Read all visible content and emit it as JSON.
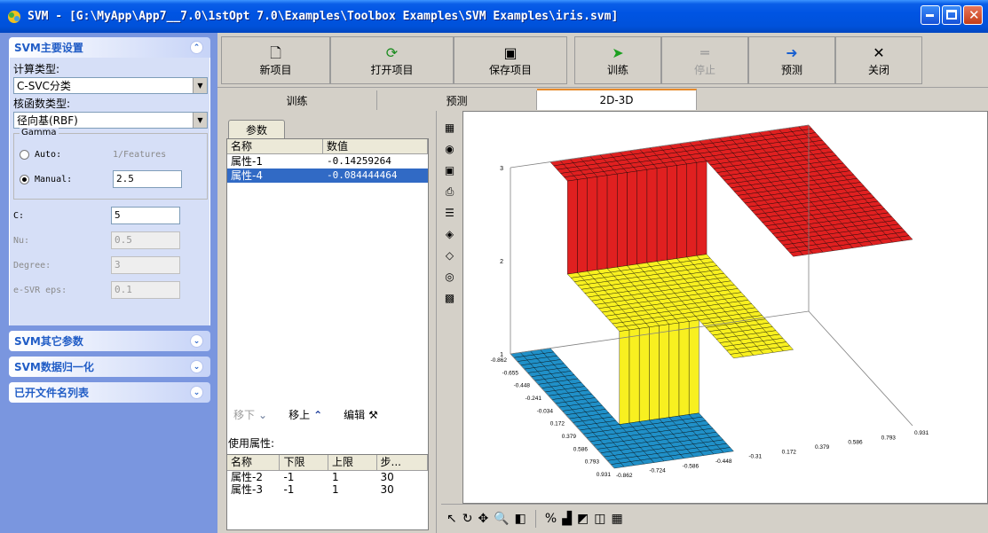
{
  "window": {
    "title": "SVM - [G:\\MyApp\\App7__7.0\\1stOpt 7.0\\Examples\\Toolbox Examples\\SVM Examples\\iris.svm]"
  },
  "left_panel": {
    "main_group": {
      "title": "SVM主要设置",
      "calc_type_label": "计算类型:",
      "calc_type_value": "C-SVC分类",
      "kernel_label": "核函数类型:",
      "kernel_value": "径向基(RBF)",
      "gamma_legend": "Gamma",
      "auto_label": "Auto:",
      "auto_value": "1/Features",
      "manual_label": "Manual:",
      "manual_value": "2.5",
      "c_label": "C:",
      "c_value": "5",
      "nu_label": "Nu:",
      "nu_value": "0.5",
      "degree_label": "Degree:",
      "degree_value": "3",
      "eps_label": "e-SVR eps:",
      "eps_value": "0.1"
    },
    "collapsed_groups": [
      {
        "title": "SVM其它参数"
      },
      {
        "title": "SVM数据归一化"
      },
      {
        "title": "已开文件名列表"
      }
    ]
  },
  "toolbar": {
    "buttons": [
      {
        "label": "新项目",
        "icon": "new-file-icon"
      },
      {
        "label": "打开项目",
        "icon": "open-icon"
      },
      {
        "label": "保存项目",
        "icon": "save-icon"
      },
      {
        "label": "训练",
        "icon": "play-icon"
      },
      {
        "label": "停止",
        "icon": "stop-icon"
      },
      {
        "label": "预测",
        "icon": "predict-icon"
      },
      {
        "label": "关闭",
        "icon": "close-icon"
      }
    ]
  },
  "tabs": [
    {
      "label": "训练"
    },
    {
      "label": "预测"
    },
    {
      "label": "2D-3D"
    }
  ],
  "params": {
    "tab_label": "参数",
    "col_name": "名称",
    "col_value": "数值",
    "rows": [
      {
        "name": "属性-1",
        "value": "-0.14259264"
      },
      {
        "name": "属性-4",
        "value": "-0.084444464"
      }
    ],
    "move_down": "移下",
    "move_up": "移上",
    "edit": "编辑",
    "use_label": "使用属性:",
    "use_cols": [
      "名称",
      "下限",
      "上限",
      "步..."
    ],
    "use_rows": [
      [
        "属性-2",
        "-1",
        "1",
        "30"
      ],
      [
        "属性-3",
        "-1",
        "1",
        "30"
      ]
    ]
  },
  "chart_data": {
    "type": "surface3d",
    "z_ticks": [
      "3",
      "2",
      "1"
    ],
    "x_ticks": [
      "-0.862",
      "-0.655",
      "-0.448",
      "-0.241",
      "-0.034",
      "0.172",
      "0.379",
      "0.586",
      "0.793",
      "0.931"
    ],
    "y_ticks": [
      "-0.862",
      "-0.724",
      "-0.586",
      "-0.448",
      "-0.31",
      "0.172",
      "0.379",
      "0.586",
      "0.793",
      "0.931"
    ],
    "colors": {
      "class1": "#2090c8",
      "class2": "#f8f020",
      "class3": "#e02020"
    }
  }
}
